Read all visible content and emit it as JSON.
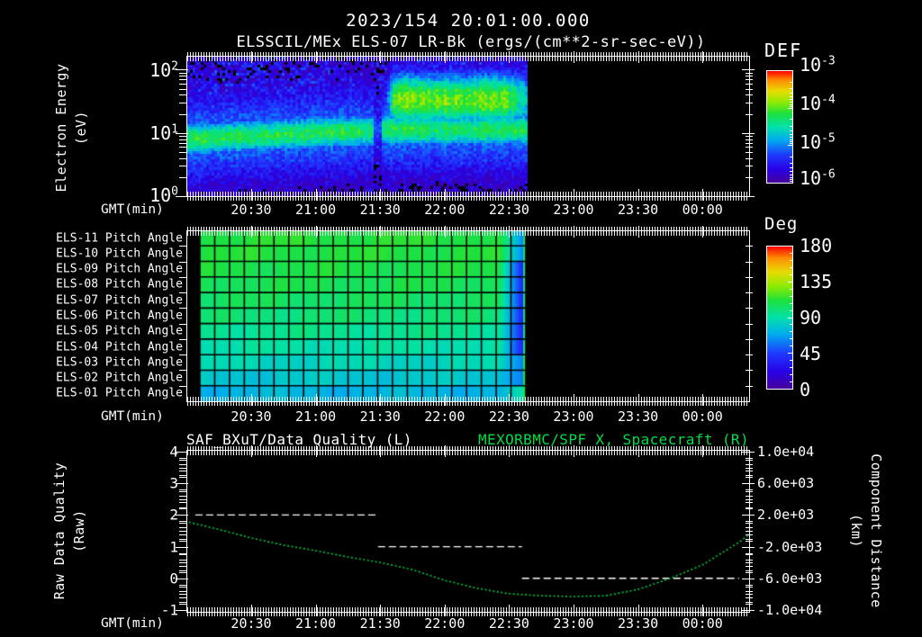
{
  "header": {
    "title": "2023/154 20:01:00.000",
    "subtitle": "ELSSCIL/MEx ELS-07 LR-Bk  (ergs/(cm**2-sr-sec-eV))"
  },
  "time_axis": {
    "label": "GMT(min)",
    "ticks": [
      "20:30",
      "21:00",
      "21:30",
      "22:00",
      "22:30",
      "23:00",
      "23:30",
      "00:00"
    ]
  },
  "top_panel": {
    "y_axis_label": "Electron Energy",
    "y_axis_label_units": "(eV)",
    "y_ticks": [
      {
        "mantissa": "10",
        "exp": "2"
      },
      {
        "mantissa": "10",
        "exp": "1"
      },
      {
        "mantissa": "10",
        "exp": "0"
      }
    ],
    "colorbar": {
      "title": "DEF",
      "ticks": [
        {
          "mantissa": "10",
          "exp": "-3"
        },
        {
          "mantissa": "10",
          "exp": "-4"
        },
        {
          "mantissa": "10",
          "exp": "-5"
        },
        {
          "mantissa": "10",
          "exp": "-6"
        }
      ]
    }
  },
  "middle_panel": {
    "row_labels": [
      "ELS-11 Pitch Angle",
      "ELS-10 Pitch Angle",
      "ELS-09 Pitch Angle",
      "ELS-08 Pitch Angle",
      "ELS-07 Pitch Angle",
      "ELS-06 Pitch Angle",
      "ELS-05 Pitch Angle",
      "ELS-04 Pitch Angle",
      "ELS-03 Pitch Angle",
      "ELS-02 Pitch Angle",
      "ELS-01 Pitch Angle"
    ],
    "colorbar": {
      "title": "Deg",
      "ticks": [
        "180",
        "135",
        "90",
        "45",
        "0"
      ]
    }
  },
  "bottom_panel": {
    "title_left": "SAF_BXuT/Data Quality (L)",
    "title_right": "MEXORBMC/SPF X, Spacecraft (R)",
    "y_left_label": "Raw Data Quality",
    "y_left_label_units": "(Raw)",
    "y_left_ticks": [
      "4",
      "3",
      "2",
      "1",
      "0",
      "-1"
    ],
    "y_right_label": "Component Distance",
    "y_right_label_units": "(km)",
    "y_right_ticks": [
      "1.0e+04",
      "6.0e+03",
      "2.0e+03",
      "-2.0e+03",
      "-6.0e+03",
      "-1.0e+04"
    ]
  },
  "colors": {
    "background": "#000000",
    "text": "#ffffff",
    "title_right_green": "#00dd44",
    "spacecraft_curve_green": "#00cc44",
    "quality_line_white": "#ffffff",
    "grid_line": "#000000",
    "rainbow": [
      [
        0,
        "#46009b"
      ],
      [
        0.12,
        "#2800e6"
      ],
      [
        0.25,
        "#1e3cff"
      ],
      [
        0.38,
        "#00aaf0"
      ],
      [
        0.5,
        "#00e1aa"
      ],
      [
        0.62,
        "#1ee13c"
      ],
      [
        0.72,
        "#8ceb00"
      ],
      [
        0.82,
        "#e6dc00"
      ],
      [
        0.92,
        "#ff8c00"
      ],
      [
        1,
        "#ff0000"
      ]
    ]
  },
  "chart_data": [
    {
      "type": "heatmap",
      "name": "electron-energy-spectrogram",
      "title": "ELSSCIL/MEx ELS-07 LR-Bk",
      "units": "ergs/(cm**2-sr-sec-eV)",
      "colorbar_label": "DEF",
      "y_scale": "log",
      "y_range_ev": [
        1,
        160
      ],
      "def_range": [
        1e-06,
        0.001
      ],
      "x_start": "20:01",
      "x_end_data": "22:38",
      "x_end_axis": "00:23",
      "features": {
        "thermal_band": {
          "energy_ev": [
            6,
            16
          ],
          "time": [
            "20:01",
            "22:38"
          ],
          "peak_def": 6e-05,
          "center_logE_start": 0.9,
          "center_logE_end": 1.05
        },
        "energized_blob": {
          "energy_ev": [
            15,
            70
          ],
          "time": [
            "21:31",
            "22:38"
          ],
          "peak_def": 0.00012,
          "center_logE": 1.52
        },
        "suprathermal_speckle": {
          "energy_ev": [
            4,
            160
          ],
          "def": 2e-06
        },
        "low_energy_floor": {
          "energy_ev": [
            1,
            4
          ],
          "def": "<1e-6"
        },
        "dropout_gap_time": "21:29"
      }
    },
    {
      "type": "heatmap",
      "name": "pitch-angle-panel",
      "rows": [
        "ELS-11",
        "ELS-10",
        "ELS-09",
        "ELS-08",
        "ELS-07",
        "ELS-06",
        "ELS-05",
        "ELS-04",
        "ELS-03",
        "ELS-02",
        "ELS-01"
      ],
      "colorbar_label": "Deg",
      "range_deg": [
        0,
        180
      ],
      "x_start": "20:01",
      "x_end_data": "22:38",
      "x_end_axis": "00:23",
      "row_mean_pitch_deg": [
        112,
        111,
        109,
        107,
        104,
        100,
        95,
        90,
        85,
        79,
        73
      ],
      "end_transition": {
        "time": [
          "22:28",
          "22:38"
        ],
        "pitch_deg_mid_rows": 32,
        "pitch_deg_outer_rows": 58,
        "final_column_deg": 100
      },
      "grid": {
        "columns": 22,
        "line_color": "#000000"
      }
    },
    {
      "type": "line",
      "name": "quality-and-distance",
      "x_range": [
        "20:01",
        "00:23"
      ],
      "series": [
        {
          "name": "SAF_BXuT/Data Quality (L)",
          "axis": "left",
          "color": "#ffffff",
          "style": "dashed_steps",
          "ylim": [
            -1,
            4
          ],
          "points": [
            [
              "20:04",
              2
            ],
            [
              "21:29",
              2
            ],
            [
              "21:29",
              1
            ],
            [
              "22:36",
              1
            ],
            [
              "22:36",
              0
            ],
            [
              "00:17",
              0
            ]
          ]
        },
        {
          "name": "MEXORBMC/SPF X, Spacecraft (R)",
          "axis": "right",
          "color": "#00cc44",
          "style": "dotted_line",
          "ylim": [
            -10000,
            10000
          ],
          "points": [
            [
              "20:01",
              1100
            ],
            [
              "20:16",
              100
            ],
            [
              "20:30",
              -900
            ],
            [
              "20:45",
              -1800
            ],
            [
              "21:00",
              -2500
            ],
            [
              "21:15",
              -3300
            ],
            [
              "21:30",
              -4000
            ],
            [
              "21:45",
              -4900
            ],
            [
              "22:00",
              -6250
            ],
            [
              "22:15",
              -7250
            ],
            [
              "22:30",
              -7950
            ],
            [
              "22:45",
              -8200
            ],
            [
              "23:00",
              -8300
            ],
            [
              "23:15",
              -8200
            ],
            [
              "23:30",
              -7400
            ],
            [
              "23:45",
              -6000
            ],
            [
              "00:00",
              -4300
            ],
            [
              "00:12",
              -2300
            ],
            [
              "00:18",
              -1250
            ],
            [
              "00:23",
              -200
            ]
          ]
        }
      ]
    }
  ]
}
